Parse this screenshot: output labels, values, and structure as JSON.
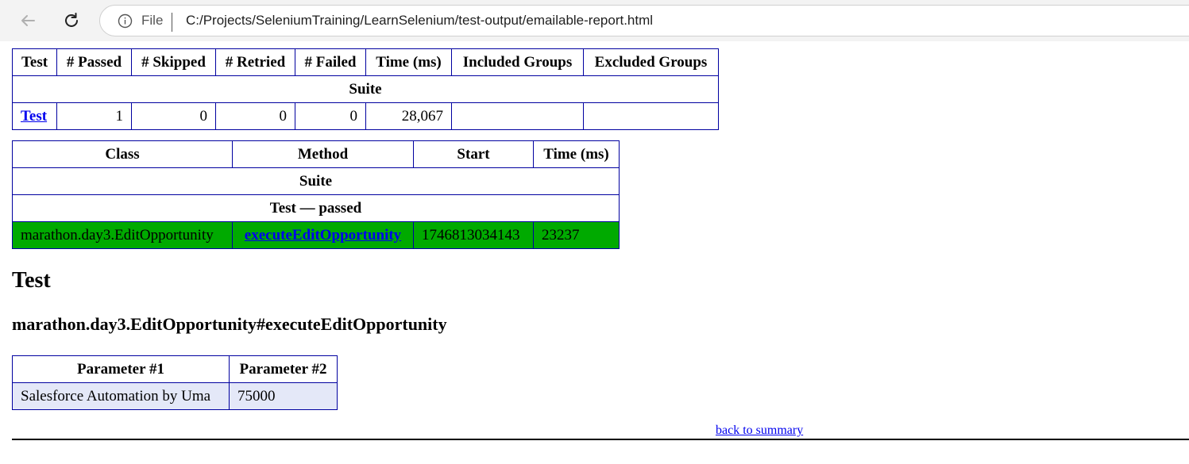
{
  "browser": {
    "file_label": "File",
    "url": "C:/Projects/SeleniumTraining/LearnSelenium/test-output/emailable-report.html"
  },
  "summary": {
    "headers": [
      "Test",
      "# Passed",
      "# Skipped",
      "# Retried",
      "# Failed",
      "Time (ms)",
      "Included Groups",
      "Excluded Groups"
    ],
    "suite_label": "Suite",
    "row": {
      "test": "Test",
      "passed": "1",
      "skipped": "0",
      "retried": "0",
      "failed": "0",
      "time": "28,067",
      "included": "",
      "excluded": ""
    }
  },
  "methods": {
    "headers": [
      "Class",
      "Method",
      "Start",
      "Time (ms)"
    ],
    "suite_label": "Suite",
    "test_label": "Test — passed",
    "row": {
      "class": "marathon.day3.EditOpportunity",
      "method": "executeEditOpportunity",
      "start": "1746813034143",
      "time": "23237"
    },
    "pass_color": "#00aa00"
  },
  "detail": {
    "test_heading": "Test",
    "method_heading": "marathon.day3.EditOpportunity#executeEditOpportunity",
    "param_headers": [
      "Parameter #1",
      "Parameter #2"
    ],
    "params": [
      "Salesforce Automation by Uma",
      "75000"
    ]
  },
  "back_link": "back to summary"
}
